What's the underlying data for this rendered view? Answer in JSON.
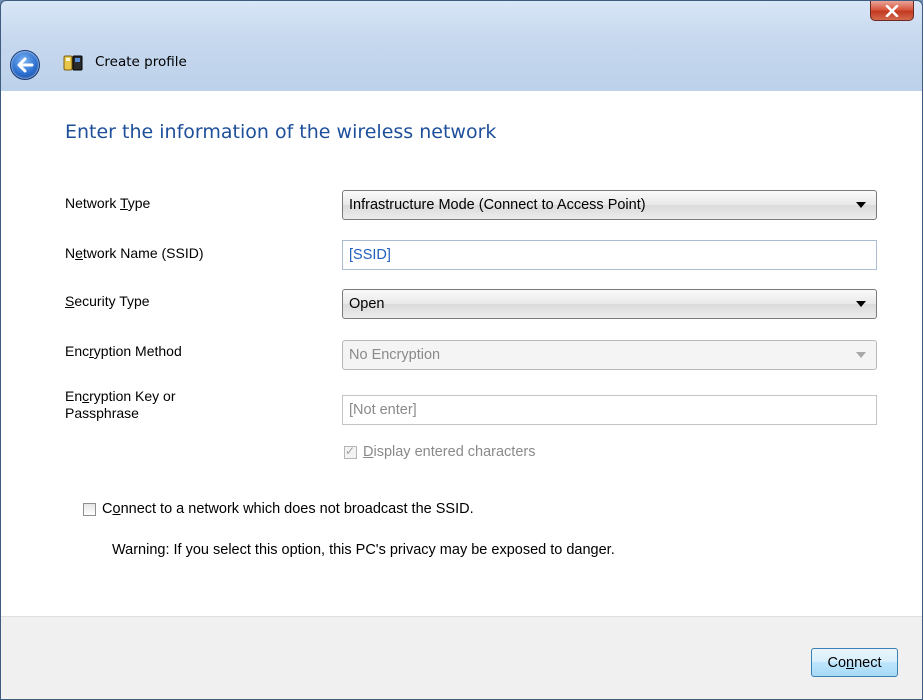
{
  "window": {
    "title": "Create profile",
    "icons": {
      "back": "back-arrow-icon",
      "app": "network-profile-icon",
      "close": "close-icon"
    }
  },
  "form": {
    "heading": "Enter the information of the wireless network",
    "network_type": {
      "label_pre": "Network ",
      "label_ul": "T",
      "label_post": "ype",
      "value": "Infrastructure Mode (Connect to Access Point)"
    },
    "ssid": {
      "label_pre": "N",
      "label_ul": "e",
      "label_post": "twork Name (SSID)",
      "value": "[SSID]"
    },
    "security_type": {
      "label_pre": "",
      "label_ul": "S",
      "label_post": "ecurity Type",
      "value": "Open"
    },
    "encryption_method": {
      "label_pre": "Enc",
      "label_ul": "r",
      "label_post": "yption Method",
      "value": "No Encryption"
    },
    "encryption_key": {
      "label_pre": "En",
      "label_ul": "c",
      "label_post": "ryption Key or",
      "label_line2": "Passphrase",
      "value": "[Not enter]"
    },
    "display_chars": {
      "label_ul": "D",
      "label_post": "isplay entered characters",
      "checked": true
    },
    "hidden_ssid": {
      "label_pre": "C",
      "label_ul": "o",
      "label_post": "nnect to a network which does not broadcast the SSID.",
      "checked": false
    },
    "warning": "Warning: If you select this option, this PC's privacy may be exposed to danger."
  },
  "footer": {
    "connect_pre": "Co",
    "connect_ul": "n",
    "connect_post": "nect"
  },
  "colors": {
    "heading": "#1e4f9a",
    "ssid_text": "#1f5fbf",
    "button_border": "#3c7fb1"
  }
}
